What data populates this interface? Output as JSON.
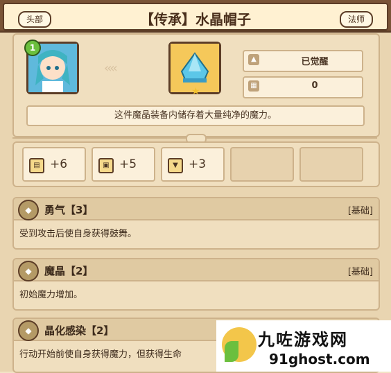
{
  "header": {
    "slot_label": "头部",
    "title": "【传承】水晶帽子",
    "class_label": "法师"
  },
  "item": {
    "level_badge": "1",
    "awaken_status": "已觉醒",
    "count_value": "0",
    "description": "这件魔晶装备内储存着大量纯净的魔力。"
  },
  "bonuses": [
    {
      "icon": "book-icon",
      "value": "+6"
    },
    {
      "icon": "scroll-icon",
      "value": "+5"
    },
    {
      "icon": "shield-icon",
      "value": "+3"
    }
  ],
  "skills": [
    {
      "name": "勇气【3】",
      "tag": "[基础]",
      "text": "受到攻击后使自身获得鼓舞。"
    },
    {
      "name": "魔晶【2】",
      "tag": "[基础]",
      "text": "初始魔力增加。"
    },
    {
      "name": "晶化感染【2】",
      "tag": "",
      "text": "行动开始前使自身获得魔力，但获得生命"
    }
  ],
  "watermark": {
    "cn": "九咗游戏网",
    "en": "91ghost.com"
  },
  "colors": {
    "frame": "#7a5437",
    "panel": "#f0dfbf",
    "gem": "#5cc7e8",
    "badge": "#6bbf3e"
  }
}
